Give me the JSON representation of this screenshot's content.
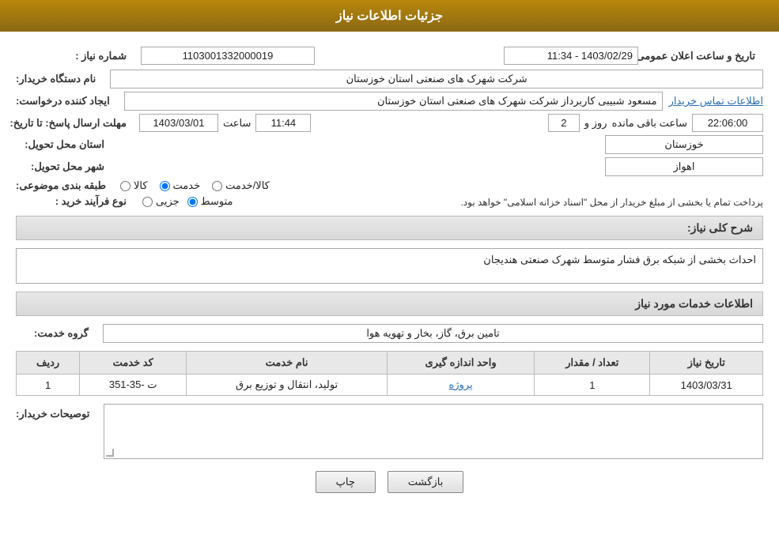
{
  "header": {
    "title": "جزئیات اطلاعات نیاز"
  },
  "fields": {
    "need_number_label": "شماره نیاز :",
    "need_number_value": "1103001332000019",
    "announce_date_label": "تاریخ و ساعت اعلان عمومی:",
    "announce_date_value": "1403/02/29 - 11:34",
    "buyer_org_label": "نام دستگاه خریدار:",
    "buyer_org_value": "شرکت شهرک های صنعتی استان خوزستان",
    "creator_label": "ایجاد کننده درخواست:",
    "creator_value": "مسعود شبیبی کاربرداز شرکت شهرک های صنعتی استان خوزستان",
    "creator_link": "اطلاعات تماس خریدار",
    "reply_deadline_label": "مهلت ارسال پاسخ: تا تاریخ:",
    "reply_date": "1403/03/01",
    "reply_time_label": "ساعت",
    "reply_time": "11:44",
    "reply_day_label": "روز و",
    "reply_days": "2",
    "reply_remaining_label": "ساعت باقی مانده",
    "reply_remaining": "22:06:00",
    "province_label": "استان محل تحویل:",
    "province_value": "خوزستان",
    "city_label": "شهر محل تحویل:",
    "city_value": "اهواز",
    "category_label": "طبقه بندی موضوعی:",
    "category_kala": "کالا",
    "category_khedmat": "خدمت",
    "category_kala_khedmat": "کالا/خدمت",
    "category_selected": "khedmat",
    "purchase_type_label": "نوع فرآیند خرید :",
    "purchase_jozei": "جزیی",
    "purchase_motevaset": "متوسط",
    "purchase_notice": "پرداخت تمام یا بخشی از مبلغ خریدار از محل \"اسناد خزانه اسلامی\" خواهد بود.",
    "description_label": "شرح کلی نیاز:",
    "description_value": "احداث بخشی از شبکه برق فشار متوسط شهرک صنعتی هندیجان",
    "services_section_title": "اطلاعات خدمات مورد نیاز",
    "service_group_label": "گروه خدمت:",
    "service_group_value": "تامین برق، گاز، بخار و تهویه هوا",
    "table": {
      "col_row": "ردیف",
      "col_code": "کد خدمت",
      "col_name": "نام خدمت",
      "col_unit": "واحد اندازه گیری",
      "col_count": "تعداد / مقدار",
      "col_date": "تاریخ نیاز",
      "rows": [
        {
          "row": "1",
          "code": "ت -35-351",
          "name": "تولید، انتقال و توزیع برق",
          "unit": "پروژه",
          "count": "1",
          "date": "1403/03/31"
        }
      ]
    },
    "buyer_notes_label": "توصیحات خریدار:",
    "back_button": "بازگشت",
    "print_button": "چاپ"
  }
}
